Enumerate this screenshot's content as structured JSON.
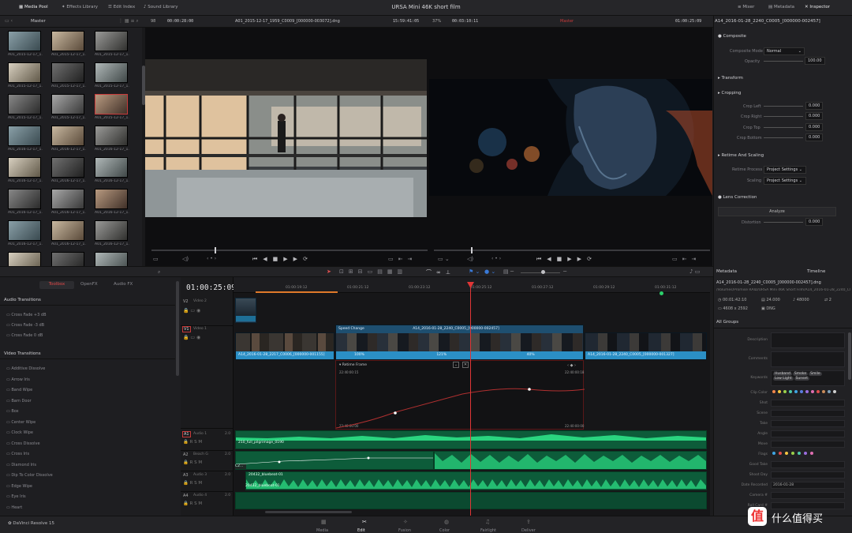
{
  "app": {
    "name": "DaVinci Resolve 15",
    "project_title": "URSA Mini 46K short film"
  },
  "topbar": {
    "left": [
      "Media Pool",
      "Effects Library",
      "Edit Index",
      "Sound Library"
    ],
    "right": [
      "Mixer",
      "Metadata",
      "Inspector"
    ]
  },
  "subbar": {
    "bin": "Master",
    "source_zoom": "98",
    "source_tc": "00:00:28:00",
    "source_clip": "A01_2015-12-17_1959_C0009_[000000-003072].dng",
    "source_dur": "15:59:41:05",
    "viewer_zoom": "37%",
    "record_tc_small": "00:03:10:11",
    "timeline_name": "Master",
    "record_tc": "01:00:25:09",
    "inspector_clip": "A14_2016-01-28_2240_C0005_[000000-002457]"
  },
  "media_pool": {
    "clips": [
      "A01_2015-12-17_1...",
      "A01_2015-12-17_1...",
      "A01_2015-12-17_1...",
      "A01_2015-12-17_1...",
      "A01_2015-12-17_1...",
      "A01_2015-12-17_1...",
      "A01_2015-12-17_1...",
      "A01_2015-12-17_1...",
      "A01_2015-12-17_1...",
      "A01_2016-12-17_1...",
      "A01_2016-12-17_1...",
      "A01_2016-12-17_1...",
      "A01_2016-12-17_1...",
      "A01_2016-12-17_1...",
      "A01_2016-12-17_1...",
      "A01_2016-12-17_1...",
      "A01_2016-12-17_1...",
      "A01_2016-12-17_1...",
      "A01_2016-12-17_1...",
      "A01_2016-12-17_1...",
      "A01_2016-12-17_1...",
      "A01_2016-12-17_1...",
      "A01_2016-12-17_1...",
      "A01_2016-12-17_1..."
    ],
    "selected_index": 8
  },
  "inspector": {
    "composite": "Composite",
    "composite_mode_label": "Composite Mode",
    "composite_mode": "Normal",
    "opacity_label": "Opacity",
    "opacity": "100.00",
    "transform": "Transform",
    "cropping": "Cropping",
    "crop_left_label": "Crop Left",
    "crop_left": "0.000",
    "crop_right_label": "Crop Right",
    "crop_right": "0.000",
    "crop_top_label": "Crop Top",
    "crop_top": "0.000",
    "crop_bottom_label": "Crop Bottom",
    "crop_bottom": "0.000",
    "retime": "Retime And Scaling",
    "retime_process_label": "Retime Process",
    "retime_process": "Project Settings",
    "scaling_label": "Scaling",
    "scaling": "Project Settings",
    "lens": "Lens Correction",
    "analyze": "Analyze",
    "distortion_label": "Distortion",
    "distortion": "0.000"
  },
  "toolbox": {
    "tabs": [
      "Toolbox",
      "OpenFX",
      "Audio FX"
    ],
    "audio_transitions": "Audio Transitions",
    "audio_items": [
      "Cross Fade +3 dB",
      "Cross Fade -3 dB",
      "Cross Fade 0 dB"
    ],
    "video_transitions": "Video Transitions",
    "video_items": [
      "Additive Dissolve",
      "Arrow Iris",
      "Band Wipe",
      "Barn Door",
      "Box",
      "Center Wipe",
      "Clock Wipe",
      "Cross Dissolve",
      "Cross Iris",
      "Diamond Iris",
      "Dip To Color Dissolve",
      "Edge Wipe",
      "Eye Iris",
      "Heart"
    ]
  },
  "tracks": {
    "v2": "V2",
    "v2_name": "Video 2",
    "v1": "V1",
    "v1_name": "Video 1",
    "a1": "A1",
    "a1_name": "Audio 1",
    "a1_ch": "2.0",
    "a2": "A2",
    "a2_name": "Beach G",
    "a2_ch": "2.0",
    "a3": "A3",
    "a3_name": "Audio 3",
    "a3_ch": "2.0",
    "a4": "A4",
    "a4_name": "Audio 4",
    "a4_ch": "2.0"
  },
  "timeline": {
    "ruler": [
      "01:00:19:12",
      "01:00:21:12",
      "01:00:23:12",
      "01:00:25:12",
      "01:00:27:12",
      "01:00:29:12",
      "01:00:31:12",
      "01:00:33:12"
    ],
    "clip1": "A14_2016-01-28_2217_C0006_[000000-001155]",
    "clip2": "A14_2016-01-28_2240_C0005_[000000-002457]",
    "clip3": "A14_2016-01-28_2240_C0005_[000000-001327]",
    "speed_change": "Speed Change",
    "retime_frame": "Retime Frame",
    "speed_pct1": "100%",
    "speed_pct2": "121%",
    "speed_pct3": "40%",
    "curve_tc_top": "22:40:00:15",
    "curve_tc_top_right": "22:40:00:18",
    "curve_tc_bottom": "22:40:00:00",
    "curve_tc_bottom_right": "22:40:00:00",
    "audio1_label": "210_full_pilgrimage_0190",
    "audio2_label": "C2...",
    "audio3_label": "20432_bluebeat-01",
    "audio3b_label": "20432_bluebeat-01"
  },
  "metadata": {
    "tab_left": "Metadata",
    "tab_right": "Timeline",
    "clip_name": "A14_2016-01-28_2240_C0005_[000000-002457].dng",
    "path": "/Volumes/Promise RAID/URSA Mini 46K Short Film/A14_2016-01-28_2240_C0005_[000000-002457]",
    "duration": "00:01:42:10",
    "fps": "24.000",
    "sample": "48000",
    "channels": "2",
    "resolution": "4608 x 2592",
    "codec": "DNG",
    "group": "All Groups",
    "fields": [
      "Description",
      "Comments",
      "Keywords",
      "Clip Color",
      "Shot",
      "Scene",
      "Take",
      "Angle",
      "Move",
      "Flags",
      "Good Take",
      "Shoot Day",
      "Date Recorded",
      "Camera #",
      "Roll Card #"
    ],
    "date_recorded": "2016-01-28",
    "keyword_tags": [
      "Husband",
      "Smoke",
      "Smile",
      "Low Light",
      "Sunset"
    ],
    "clip_colors": [
      "#f2874a",
      "#f4c542",
      "#9ad04a",
      "#4ec9a8",
      "#3fa6e3",
      "#5a7de0",
      "#9b6ee0",
      "#e06fb1",
      "#e04d4d",
      "#c98c5a",
      "#7fa0b8",
      "#d0d0d0"
    ],
    "flag_colors": [
      "#3fa6e3",
      "#e04d4d",
      "#f4c542",
      "#9ad04a",
      "#4ec9a8",
      "#9b6ee0",
      "#e06fb1"
    ]
  },
  "pages": [
    "Media",
    "Edit",
    "Fusion",
    "Color",
    "Fairlight",
    "Deliver"
  ],
  "active_page": "Edit",
  "watermark": "值 什么值得买",
  "colors": {
    "accent": "#c83a3a",
    "v1_clip": "#1e6f97",
    "v1_clip_bar": "#2b8fc5",
    "audio": "#1aa06a",
    "playhead": "#e03636"
  }
}
